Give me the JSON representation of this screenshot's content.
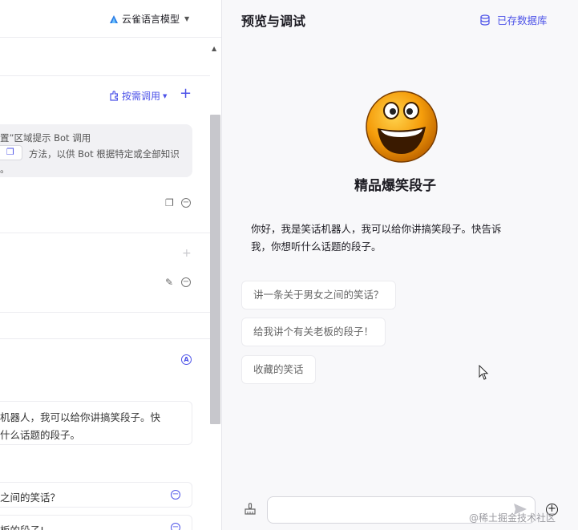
{
  "left_panel": {
    "model_selector": {
      "label": "云雀语言模型",
      "icon": "triangle-logo-icon"
    },
    "knowledge": {
      "on_demand_label": "按需调用",
      "hint_line1": "置”区域提示 Bot 调用",
      "hint_line2": "方法，以供 Bot 根据特定或全部知识",
      "hint_line3": "。"
    },
    "greeting": {
      "line1": "机器人，我可以给你讲搞笑段子。快",
      "line2": "什么话题的段子。"
    },
    "suggestions": [
      {
        "text": "之间的笑话？"
      },
      {
        "text": "板的段子!"
      }
    ]
  },
  "preview": {
    "title": "预览与调试",
    "saved_label": "已存数据库",
    "bot_name": "精品爆笑段子",
    "intro_line1": "你好，我是笑话机器人，我可以给你讲搞笑段子。快告诉",
    "intro_line2": "我，你想听什么话题的段子。",
    "chips": [
      {
        "text": "讲一条关于男女之间的笑话？"
      },
      {
        "text": "给我讲个有关老板的段子！"
      },
      {
        "text": "收藏的笑话"
      }
    ],
    "input_placeholder": ""
  },
  "watermark": "@稀土掘金技术社区",
  "colors": {
    "accent": "#4d53e8",
    "panel_bg": "#f8f8fa",
    "avatar": "#f59d0b"
  }
}
